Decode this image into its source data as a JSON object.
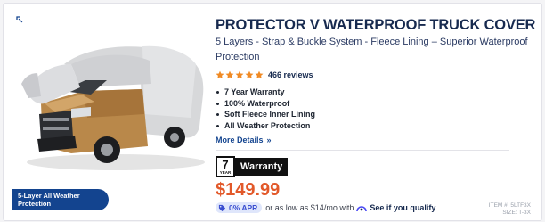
{
  "product": {
    "title": "PROTECTOR V WATERPROOF TRUCK COVER",
    "subtitle": "5 Layers - Strap & Buckle System - Fleece Lining – Superior Waterproof Protection",
    "image_badge": "5-Layer All Weather Protection",
    "rating": {
      "stars": 5,
      "reviews_label": "466 reviews"
    },
    "features": [
      "7 Year Warranty",
      "100% Waterproof",
      "Soft Fleece Inner Lining",
      "All Weather Protection"
    ],
    "more_details_label": "More Details",
    "warranty": {
      "years": "7",
      "year_label": "YEAR",
      "label": "Warranty"
    },
    "price": "$149.99",
    "financing": {
      "apr_label": "0% APR",
      "text": "or as low as $14/mo with",
      "qualify_link": "See if you qualify"
    },
    "item_number": "ITEM #: 5LTF3X",
    "size": "SIZE: T-3X"
  },
  "icons": {
    "star": "star-icon",
    "chevron": "double-chevron-right-icon",
    "tag": "tag-icon",
    "affirm": "affirm-logo-icon",
    "corner": "expand-icon"
  },
  "colors": {
    "title": "#172a4f",
    "price": "#e2592a",
    "star": "#f08a24",
    "badge": "#13448f",
    "apr_bg": "#dfe6fb",
    "apr_text": "#3a4ed0"
  }
}
